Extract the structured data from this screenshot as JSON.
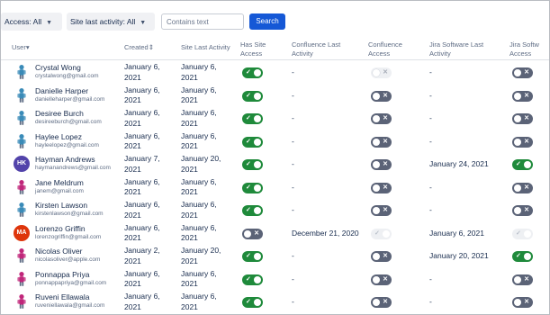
{
  "filters": {
    "access": {
      "label": "Access: All"
    },
    "site_last_activity": {
      "label": "Site last activity: All"
    },
    "text_placeholder": "Contains text",
    "search_label": "Search"
  },
  "columns": {
    "user": "User",
    "created": "Created",
    "site_last_activity": "Site Last Activity",
    "has_site_access_1": "Has Site",
    "has_site_access_2": "Access",
    "confluence_last_1": "Confluence Last",
    "confluence_last_2": "Activity",
    "confluence_access_1": "Confluence",
    "confluence_access_2": "Access",
    "jira_last_1": "Jira Software Last",
    "jira_last_2": "Activity",
    "jira_access_1": "Jira Softw",
    "jira_access_2": "Access"
  },
  "colors": {
    "toggle_on": "#1f8a3b",
    "toggle_off": "#5b6377",
    "search_button": "#1558d6"
  },
  "users": [
    {
      "name": "Crystal Wong",
      "email": "crystalwong@gmail.com",
      "avatar": "figure-icon",
      "avatar_color": "#3a8bb8",
      "created_1": "January 6,",
      "created_2": "2021",
      "last_1": "January 6,",
      "last_2": "2021",
      "has_site": "on",
      "conf_last": "-",
      "conf_access": "off-disabled",
      "jira_last": "-",
      "jira_access": "off"
    },
    {
      "name": "Danielle Harper",
      "email": "danielleharper@gmail.com",
      "avatar": "figure-icon",
      "avatar_color": "#3a8bb8",
      "created_1": "January 6,",
      "created_2": "2021",
      "last_1": "January 6,",
      "last_2": "2021",
      "has_site": "on",
      "conf_last": "-",
      "conf_access": "off",
      "jira_last": "-",
      "jira_access": "off"
    },
    {
      "name": "Desiree Burch",
      "email": "desireeburch@gmail.com",
      "avatar": "figure-icon",
      "avatar_color": "#3a8bb8",
      "created_1": "January 6,",
      "created_2": "2021",
      "last_1": "January 6,",
      "last_2": "2021",
      "has_site": "on",
      "conf_last": "-",
      "conf_access": "off",
      "jira_last": "-",
      "jira_access": "off"
    },
    {
      "name": "Haylee Lopez",
      "email": "hayleelopez@gmail.com",
      "avatar": "figure-icon",
      "avatar_color": "#3a8bb8",
      "created_1": "January 6,",
      "created_2": "2021",
      "last_1": "January 6,",
      "last_2": "2021",
      "has_site": "on",
      "conf_last": "-",
      "conf_access": "off",
      "jira_last": "-",
      "jira_access": "off"
    },
    {
      "name": "Hayman Andrews",
      "email": "haymanandrews@gmail.com",
      "avatar": "initials",
      "initials": "HK",
      "avatar_color": "#5243aa",
      "created_1": "January 7,",
      "created_2": "2021",
      "last_1": "January 20,",
      "last_2": "2021",
      "has_site": "on",
      "conf_last": "-",
      "conf_access": "off",
      "jira_last": "January 24, 2021",
      "jira_access": "on"
    },
    {
      "name": "Jane Meldrum",
      "email": "janem@gmail.com",
      "avatar": "figure-icon",
      "avatar_color": "#c0267a",
      "created_1": "January 6,",
      "created_2": "2021",
      "last_1": "January 6,",
      "last_2": "2021",
      "has_site": "on",
      "conf_last": "-",
      "conf_access": "off",
      "jira_last": "-",
      "jira_access": "off"
    },
    {
      "name": "Kirsten Lawson",
      "email": "kirstenlawson@gmail.com",
      "avatar": "figure-icon",
      "avatar_color": "#3a8bb8",
      "created_1": "January 6,",
      "created_2": "2021",
      "last_1": "January 6,",
      "last_2": "2021",
      "has_site": "on",
      "conf_last": "-",
      "conf_access": "off",
      "jira_last": "-",
      "jira_access": "off"
    },
    {
      "name": "Lorenzo Griffin",
      "email": "lorenzogriffin@gmail.com",
      "avatar": "initials",
      "initials": "MA",
      "avatar_color": "#de350b",
      "created_1": "January 6,",
      "created_2": "2021",
      "last_1": "January 6,",
      "last_2": "2021",
      "has_site": "off",
      "conf_last": "December 21, 2020",
      "conf_access": "on-disabled",
      "jira_last": "January 6, 2021",
      "jira_access": "on-disabled"
    },
    {
      "name": "Nicolas Oliver",
      "email": "nicolasoliver@apple.com",
      "avatar": "figure-icon",
      "avatar_color": "#c0267a",
      "created_1": "January 2,",
      "created_2": "2021",
      "last_1": "January 20,",
      "last_2": "2021",
      "has_site": "on",
      "conf_last": "-",
      "conf_access": "off",
      "jira_last": "January 20, 2021",
      "jira_access": "on"
    },
    {
      "name": "Ponnappa Priya",
      "email": "ponnappapriya@gmail.com",
      "avatar": "figure-icon",
      "avatar_color": "#c0267a",
      "created_1": "January 6,",
      "created_2": "2021",
      "last_1": "January 6,",
      "last_2": "2021",
      "has_site": "on",
      "conf_last": "-",
      "conf_access": "off",
      "jira_last": "-",
      "jira_access": "off"
    },
    {
      "name": "Ruveni Ellawala",
      "email": "ruveniellawala@gmail.com",
      "avatar": "figure-icon",
      "avatar_color": "#c0267a",
      "created_1": "January 6,",
      "created_2": "2021",
      "last_1": "January 6,",
      "last_2": "2021",
      "has_site": "on",
      "conf_last": "-",
      "conf_access": "off",
      "jira_last": "-",
      "jira_access": "off"
    }
  ]
}
